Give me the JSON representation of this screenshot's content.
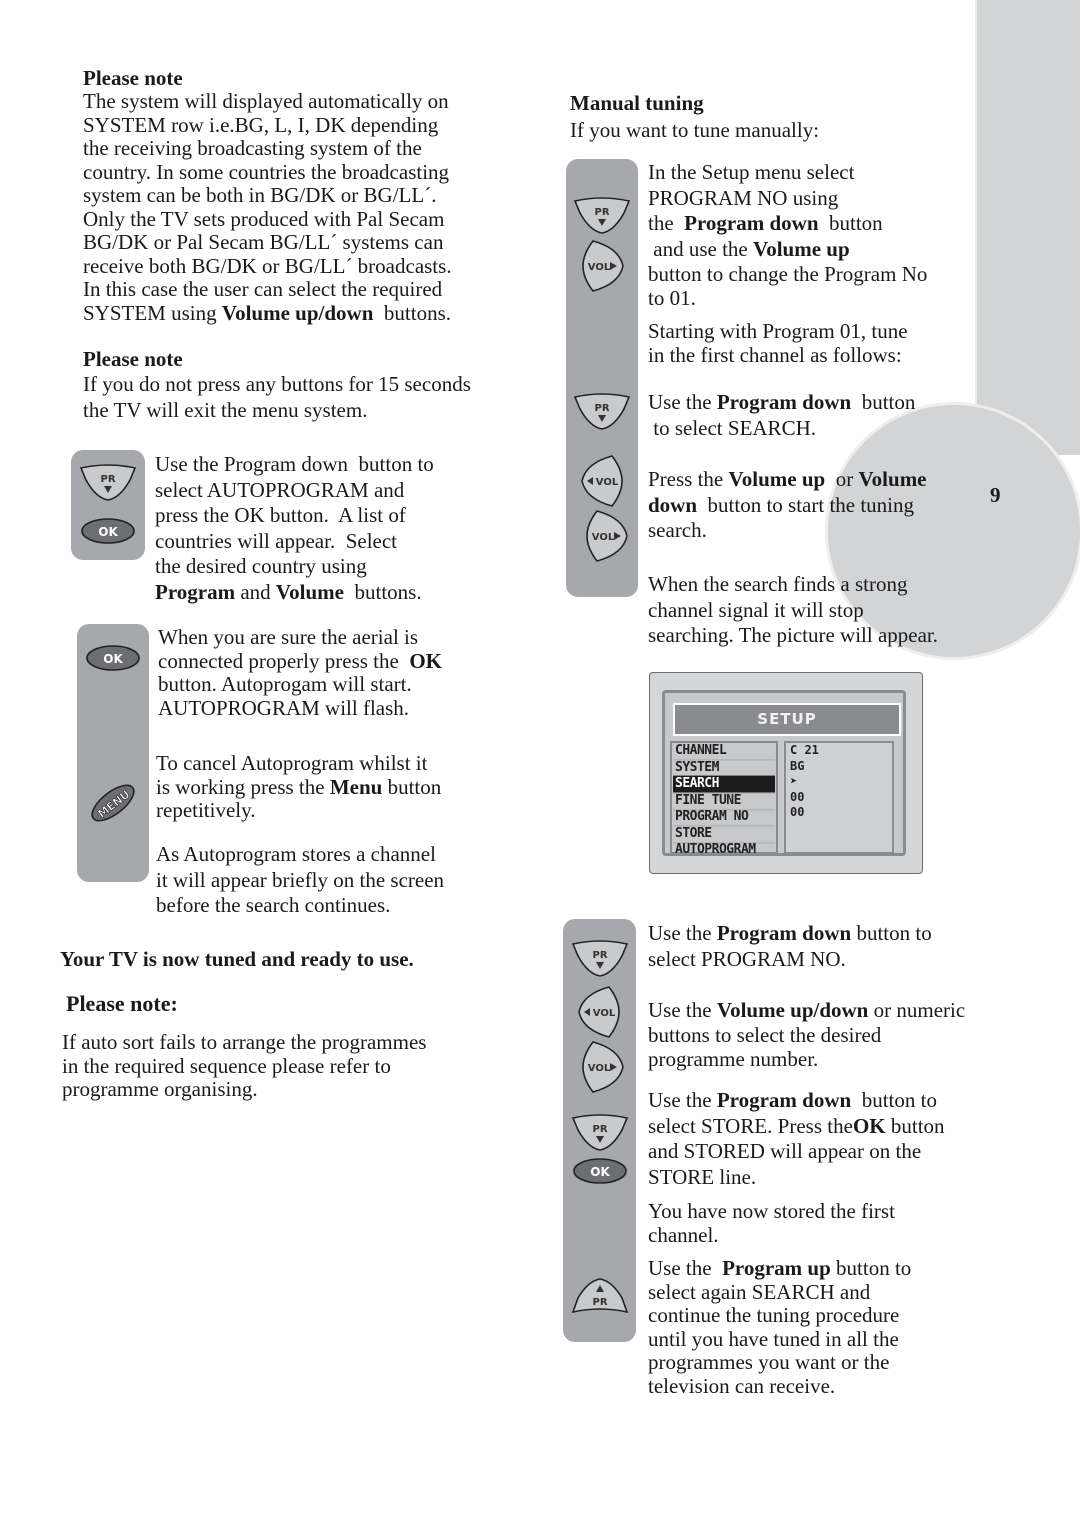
{
  "page_number": "9",
  "left_column": {
    "note1": {
      "heading": "Please note",
      "lines": [
        "The system will displayed automatically on",
        "SYSTEM row i.e.BG, L, I, DK depending",
        "the receiving broadcasting system of the",
        "country. In some countries the broadcasting",
        "system can be both in BG/DK or BG/LL´.",
        "Only the TV sets produced with Pal Secam",
        "BG/DK or Pal Secam BG/LL´ systems can",
        "receive both BG/DK or BG/LL´ broadcasts.",
        "In this case the user can select  the required"
      ],
      "last_line_pre": "SYSTEM using ",
      "last_line_bold": "Volume up/down",
      "last_line_post": "  buttons."
    },
    "note2": {
      "heading": "Please note",
      "lines": [
        "If you do not press any buttons for 15 seconds",
        "the TV will exit the menu system."
      ]
    },
    "step_autoprogram": {
      "buttons": [
        "PR ▼",
        "OK"
      ],
      "lines": [
        "Use the Program down  button to",
        "select AUTOPROGRAM and",
        "press the OK button.  A list of",
        "countries will appear.  Select",
        "the desired country using"
      ],
      "last_bold1": "Program",
      "last_mid": " and ",
      "last_bold2": "Volume",
      "last_post": "  buttons."
    },
    "step_start": {
      "button": "OK",
      "line1": "When you are sure the aerial is",
      "line2_pre": "connected properly press the  ",
      "line2_bold": "OK",
      "line3": "button. Autoprogam will start.",
      "line4": "AUTOPROGRAM will flash."
    },
    "step_cancel": {
      "button": "MENU",
      "line1": "To cancel Autoprogram whilst it",
      "line2_pre": "is working press the ",
      "line2_bold": "Menu",
      "line2_post": " button",
      "line3": "repetitively."
    },
    "step_store": {
      "lines": [
        "As Autoprogram stores a channel",
        "it will appear briefly on the screen",
        "before the search continues."
      ]
    },
    "ready": "Your TV is now tuned and ready to use.",
    "note3": {
      "heading": "Please note:",
      "lines": [
        "If auto sort fails to arrange the programmes",
        "in the required sequence please refer to",
        "programme organising."
      ]
    }
  },
  "right_column": {
    "heading": "Manual  tuning",
    "intro": "If you want to tune manually:",
    "step1": {
      "buttons": [
        "PR ▼",
        "VOL ▶"
      ],
      "line1": "In the Setup menu select",
      "line2": "PROGRAM NO using",
      "line3_pre": "the  ",
      "line3_bold": "Program down",
      "line3_post": "  button",
      "line4_pre": " and use the ",
      "line4_bold": "Volume up",
      "line5": "button to change the Program No",
      "line6": "to 01."
    },
    "step2": {
      "lines": [
        "Starting with Program 01, tune",
        "in the first channel as follows:"
      ]
    },
    "step3": {
      "button": "PR ▼",
      "line1_pre": "Use the ",
      "line1_bold": "Program down",
      "line1_post": "  button",
      "line2": " to select SEARCH."
    },
    "step4": {
      "buttons": [
        "◀ VOL",
        "VOL ▶"
      ],
      "line1_pre": "Press the ",
      "line1_bold1": "Volume up",
      "line1_mid": "  or ",
      "line1_bold2": "Volume",
      "line2_bold": "down",
      "line2_post": "  button to start the tuning",
      "line3": "search."
    },
    "step5": {
      "lines": [
        "When the search finds a strong",
        "channel signal it will stop",
        "searching. The picture will appear."
      ]
    },
    "setup_menu": {
      "title": "SETUP",
      "items": [
        "CHANNEL",
        "SYSTEM",
        "SEARCH",
        "FINE TUNE",
        "PROGRAM NO",
        "STORE",
        "AUTOPROGRAM"
      ],
      "selected": "SEARCH",
      "values": [
        "C 21",
        "BG",
        "➤",
        "00",
        "00",
        "",
        ""
      ]
    },
    "step6": {
      "button": "PR ▼",
      "line1_pre": "Use the ",
      "line1_bold": "Program down",
      "line1_post": " button to",
      "line2": "select PROGRAM NO."
    },
    "step7": {
      "buttons": [
        "◀ VOL",
        "VOL ▶"
      ],
      "line1_pre": "Use the ",
      "line1_bold": "Volume up/down",
      "line1_post": " or numeric",
      "line2": "buttons to select the desired",
      "line3": "programme number."
    },
    "step8": {
      "buttons": [
        "PR ▼",
        "OK"
      ],
      "line1_pre": "Use the ",
      "line1_bold": "Program down",
      "line1_post": "  button to",
      "line2_pre": "select STORE. Press the",
      "line2_bold": "OK",
      "line2_post": " button",
      "line3": "and STORED will appear on the",
      "line4": "STORE line."
    },
    "step9": {
      "lines": [
        "You have now stored the first",
        "channel."
      ]
    },
    "step10": {
      "button": "▲ PR",
      "line1_pre": "Use the  ",
      "line1_bold": "Program up",
      "line1_post": " button to",
      "lines": [
        "select again SEARCH and",
        "continue the tuning procedure",
        "until you have tuned in all the",
        "programmes you want or the",
        "television can receive."
      ]
    }
  }
}
